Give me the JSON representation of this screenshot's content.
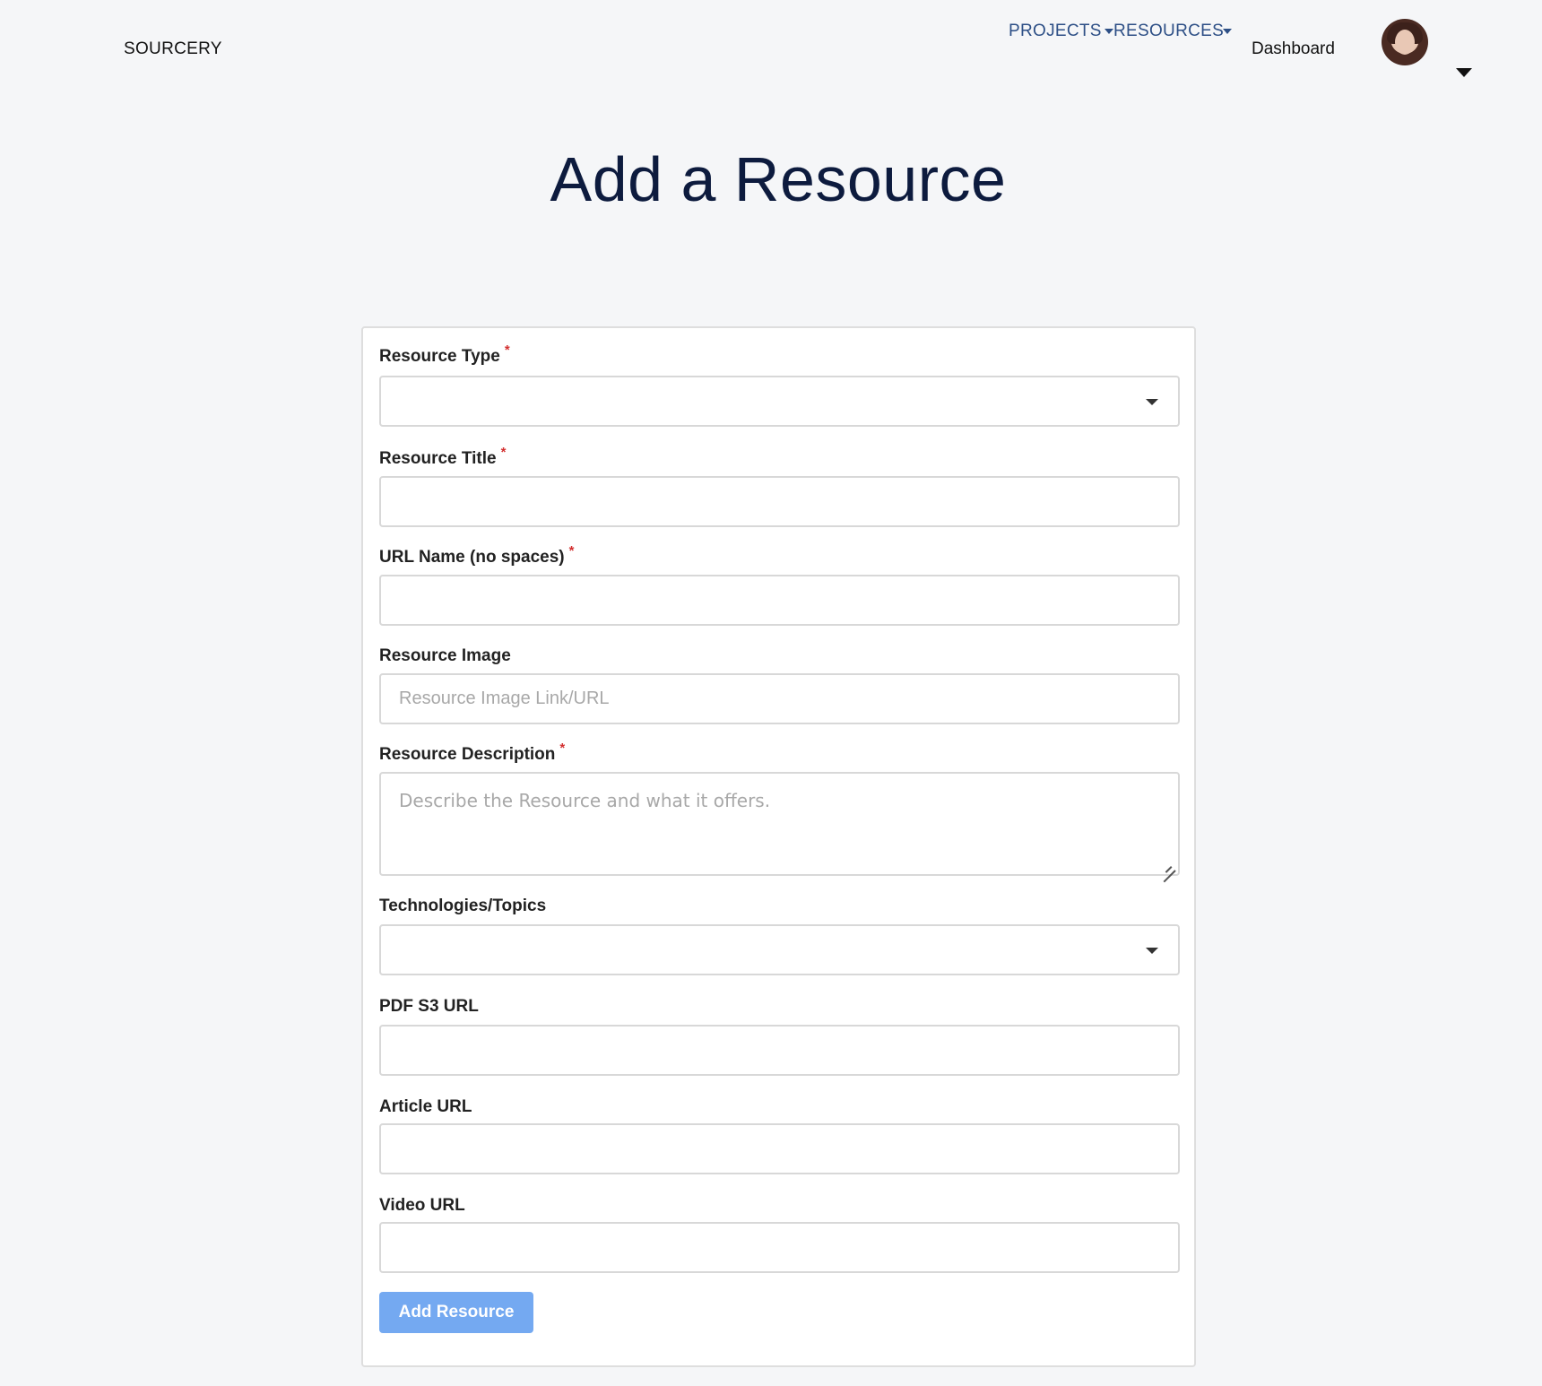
{
  "header": {
    "brand": "SOURCERY",
    "nav": {
      "projects": "PROJECTS",
      "resources": "RESOURCES",
      "dashboard": "Dashboard"
    }
  },
  "page": {
    "title": "Add a Resource"
  },
  "form": {
    "fields": {
      "resource_type": {
        "label": "Resource Type",
        "required_mark": "*",
        "value": ""
      },
      "resource_title": {
        "label": "Resource Title",
        "required_mark": "*",
        "value": ""
      },
      "url_name": {
        "label": "URL Name (no spaces)",
        "required_mark": "*",
        "value": ""
      },
      "resource_image": {
        "label": "Resource Image",
        "placeholder": "Resource Image Link/URL",
        "value": ""
      },
      "resource_description": {
        "label": "Resource Description",
        "required_mark": "*",
        "placeholder": "Describe the Resource and what it offers.",
        "value": ""
      },
      "technologies": {
        "label": "Technologies/Topics",
        "value": ""
      },
      "pdf_url": {
        "label": "PDF S3 URL",
        "value": ""
      },
      "article_url": {
        "label": "Article URL",
        "value": ""
      },
      "video_url": {
        "label": "Video URL",
        "value": ""
      }
    },
    "submit_label": "Add Resource"
  },
  "colors": {
    "nav_link": "#2d4f86",
    "title": "#0d1b3e",
    "required": "#d32f2f",
    "button": "#74a9f1"
  }
}
